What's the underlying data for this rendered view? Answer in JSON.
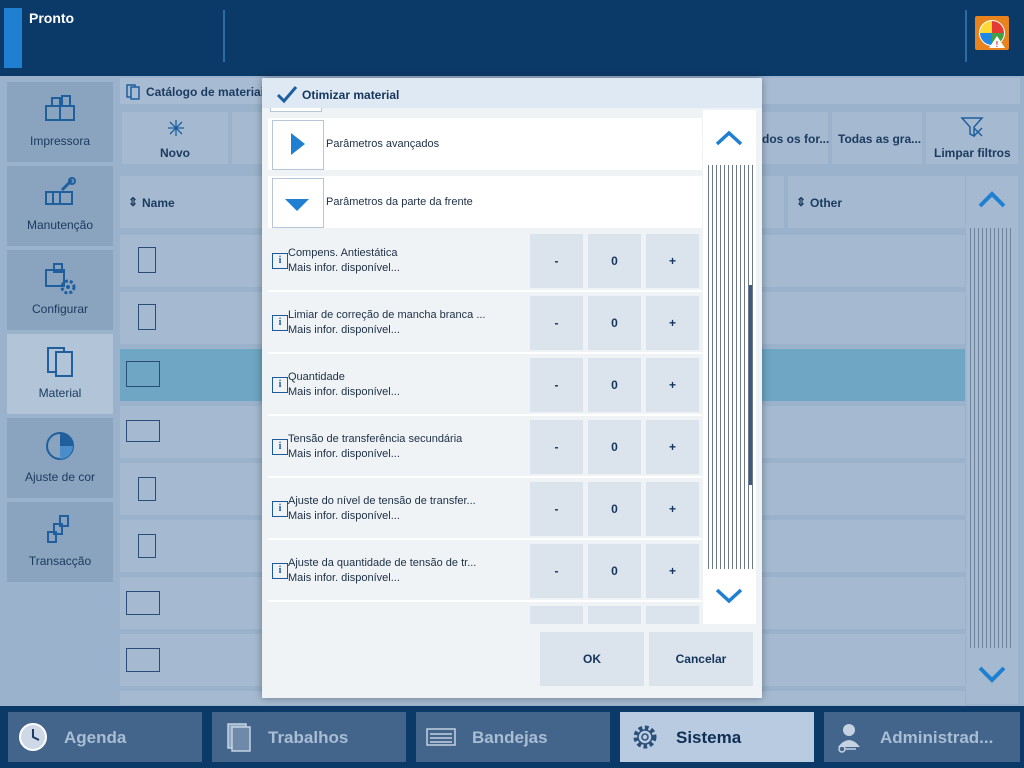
{
  "status": {
    "text": "Pronto"
  },
  "sidebar": {
    "items": [
      {
        "label": "Impressora"
      },
      {
        "label": "Manutenção"
      },
      {
        "label": "Configurar"
      },
      {
        "label": "Material"
      },
      {
        "label": "Ajuste de cor"
      },
      {
        "label": "Transacção"
      }
    ]
  },
  "catalog": {
    "title": "Catálogo de materiai",
    "toolbar": {
      "new": "Novo",
      "all_formats": "dos os for...",
      "all_weights": "Todas as gra...",
      "clear_filters": "Limpar filtros"
    },
    "columns": {
      "name": "Name",
      "other": "Other"
    }
  },
  "dialog": {
    "title": "Otimizar material",
    "sections": [
      {
        "label": "Parâmetros avançados"
      },
      {
        "label": "Parâmetros da parte da frente"
      }
    ],
    "params": [
      {
        "name": "Compens. Antiestática",
        "sub": "Mais infor. disponível...",
        "minus": "-",
        "value": "0",
        "plus": "+"
      },
      {
        "name": "Limiar de correção de mancha branca ...",
        "sub": "Mais infor. disponível...",
        "minus": "-",
        "value": "0",
        "plus": "+"
      },
      {
        "name": "Quantidade",
        "sub": "Mais infor. disponível...",
        "minus": "-",
        "value": "0",
        "plus": "+"
      },
      {
        "name": "Tensão de transferência secundária",
        "sub": "Mais infor. disponível...",
        "minus": "-",
        "value": "0",
        "plus": "+"
      },
      {
        "name": "Ajuste do nível de tensão de transfer...",
        "sub": "Mais infor. disponível...",
        "minus": "-",
        "value": "0",
        "plus": "+"
      },
      {
        "name": "Ajuste da quantidade de tensão de tr...",
        "sub": "Mais infor. disponível...",
        "minus": "-",
        "value": "0",
        "plus": "+"
      }
    ],
    "ok": "OK",
    "cancel": "Cancelar"
  },
  "bottom_nav": [
    {
      "label": "Agenda"
    },
    {
      "label": "Trabalhos"
    },
    {
      "label": "Bandejas"
    },
    {
      "label": "Sistema"
    },
    {
      "label": "Administrad..."
    }
  ],
  "colors": {
    "nav_bg": "#0b3a69",
    "accent": "#1f7fd0",
    "selected_row": "#6ea6c3",
    "logo": "#e8831d"
  }
}
